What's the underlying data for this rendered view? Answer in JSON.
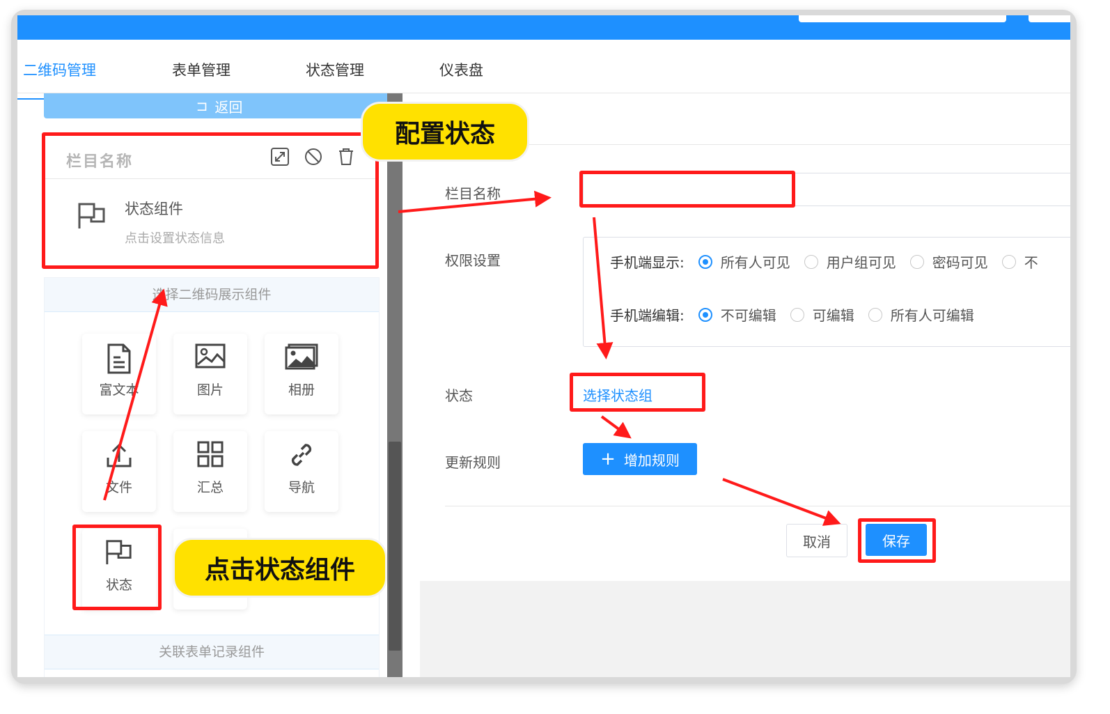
{
  "tabs": [
    "二维码管理",
    "表单管理",
    "状态管理",
    "仪表盘"
  ],
  "left": {
    "back_label": "返回",
    "card_title": "栏目名称",
    "component_name": "状态组件",
    "component_hint": "点击设置状态信息",
    "select_header": "选择二维码展示组件",
    "tiles": [
      "富文本",
      "图片",
      "相册",
      "文件",
      "汇总",
      "导航",
      "状态"
    ],
    "footer_header": "关联表单记录组件"
  },
  "form": {
    "column_name_label": "栏目名称",
    "column_name_value": "",
    "permission_label": "权限设置",
    "mobile_display_label": "手机端显示:",
    "mobile_display_options": [
      "所有人可见",
      "用户组可见",
      "密码可见",
      "不"
    ],
    "mobile_edit_label": "手机端编辑:",
    "mobile_edit_options": [
      "不可编辑",
      "可编辑",
      "所有人可编辑"
    ],
    "status_label": "状态",
    "status_link": "选择状态组",
    "rule_label": "更新规则",
    "add_rule_button": "增加规则",
    "cancel_button": "取消",
    "save_button": "保存"
  },
  "callouts": {
    "configure": "配置状态",
    "click_component": "点击状态组件"
  },
  "colors": {
    "primary": "#1e90ff",
    "annotation_red": "#ff1a1a",
    "callout_yellow": "#ffe100"
  }
}
